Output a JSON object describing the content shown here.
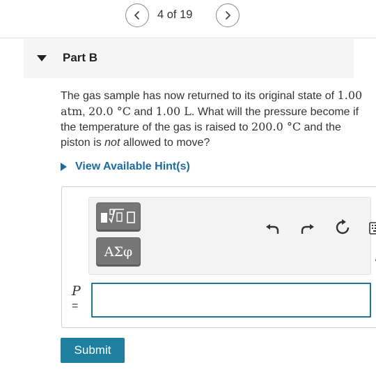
{
  "pager": {
    "prev_icon": "chevron-left-icon",
    "next_icon": "chevron-right-icon",
    "text": "4 of 19"
  },
  "part": {
    "title": "Part B",
    "toggle_icon": "triangle-down-icon"
  },
  "question": {
    "t1": "The gas sample has now returned to its original state of ",
    "m1": "1.00 atm",
    "t2": ", ",
    "m2": "20.0 °C",
    "t3": " and ",
    "m3": "1.00 L",
    "t4": ". What will the pressure become if the temperature of the gas is raised to ",
    "m4": "200.0 °C",
    "t5": " and the piston is ",
    "emph": "not",
    "t6": " allowed to move?"
  },
  "hint": {
    "label": "View Available Hint(s)"
  },
  "toolbar": {
    "templates_icon": "math-templates-icon",
    "greek_label": "ΑΣφ",
    "undo_icon": "undo-icon",
    "redo_icon": "redo-icon",
    "reset_icon": "reset-icon",
    "keyboard_icon": "keyboard-icon",
    "help_label": "?"
  },
  "answer": {
    "variable": "P",
    "equals": "=",
    "value": ""
  },
  "submit": {
    "label": "Submit"
  },
  "colors": {
    "accent": "#1f7f9e",
    "link": "#1b6c9c",
    "input_border": "#1b7a94"
  }
}
